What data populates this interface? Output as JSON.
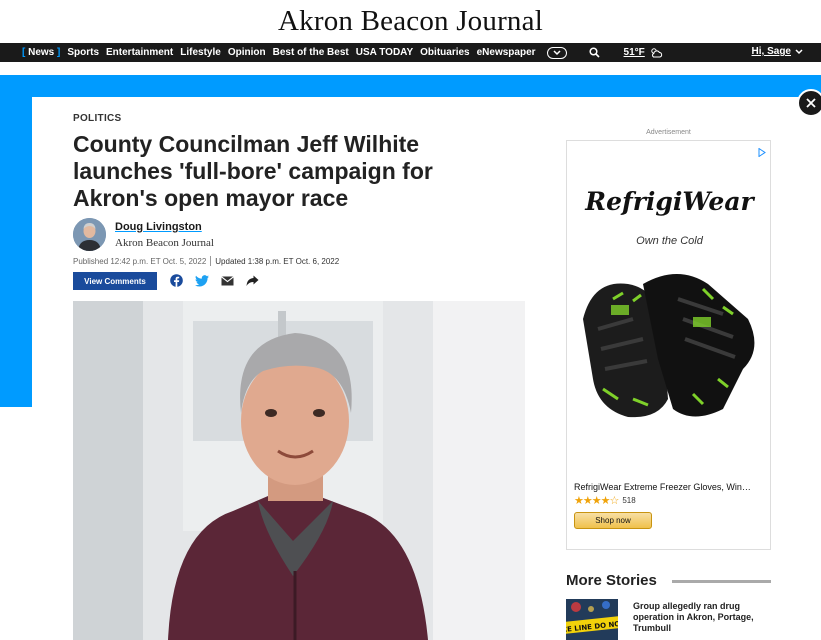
{
  "masthead": {
    "title": "Akron Beacon Journal"
  },
  "nav": {
    "items": [
      {
        "label": "News",
        "active": true
      },
      {
        "label": "Sports"
      },
      {
        "label": "Entertainment"
      },
      {
        "label": "Lifestyle"
      },
      {
        "label": "Opinion"
      },
      {
        "label": "Best of the Best"
      },
      {
        "label": "USA TODAY"
      },
      {
        "label": "Obituaries"
      },
      {
        "label": "eNewspaper"
      }
    ],
    "weather_temp": "51°F",
    "greeting": "Hi, Sage",
    "accent_color": "#009bff"
  },
  "article": {
    "section": "POLITICS",
    "headline": "County Councilman Jeff Wilhite launches 'full-bore' campaign for Akron's open mayor race",
    "author": "Doug Livingston",
    "organization": "Akron Beacon Journal",
    "published": "Published 12:42 p.m. ET Oct. 5, 2022",
    "updated": "Updated 1:38 p.m. ET Oct. 6, 2022",
    "view_comments": "View Comments"
  },
  "ad": {
    "label": "Advertisement",
    "brand": "RefrigiWear",
    "tagline": "Own the Cold",
    "product_name": "RefrigiWear Extreme Freezer Gloves, Win…",
    "rating": 4.5,
    "rating_count": "518",
    "shop_label": "Shop now"
  },
  "more_stories": {
    "title": "More Stories",
    "items": [
      {
        "title": "Group allegedly ran drug operation in Akron, Portage, Trumbull",
        "thumb_text": "ICE LINE DO NOT"
      }
    ]
  }
}
